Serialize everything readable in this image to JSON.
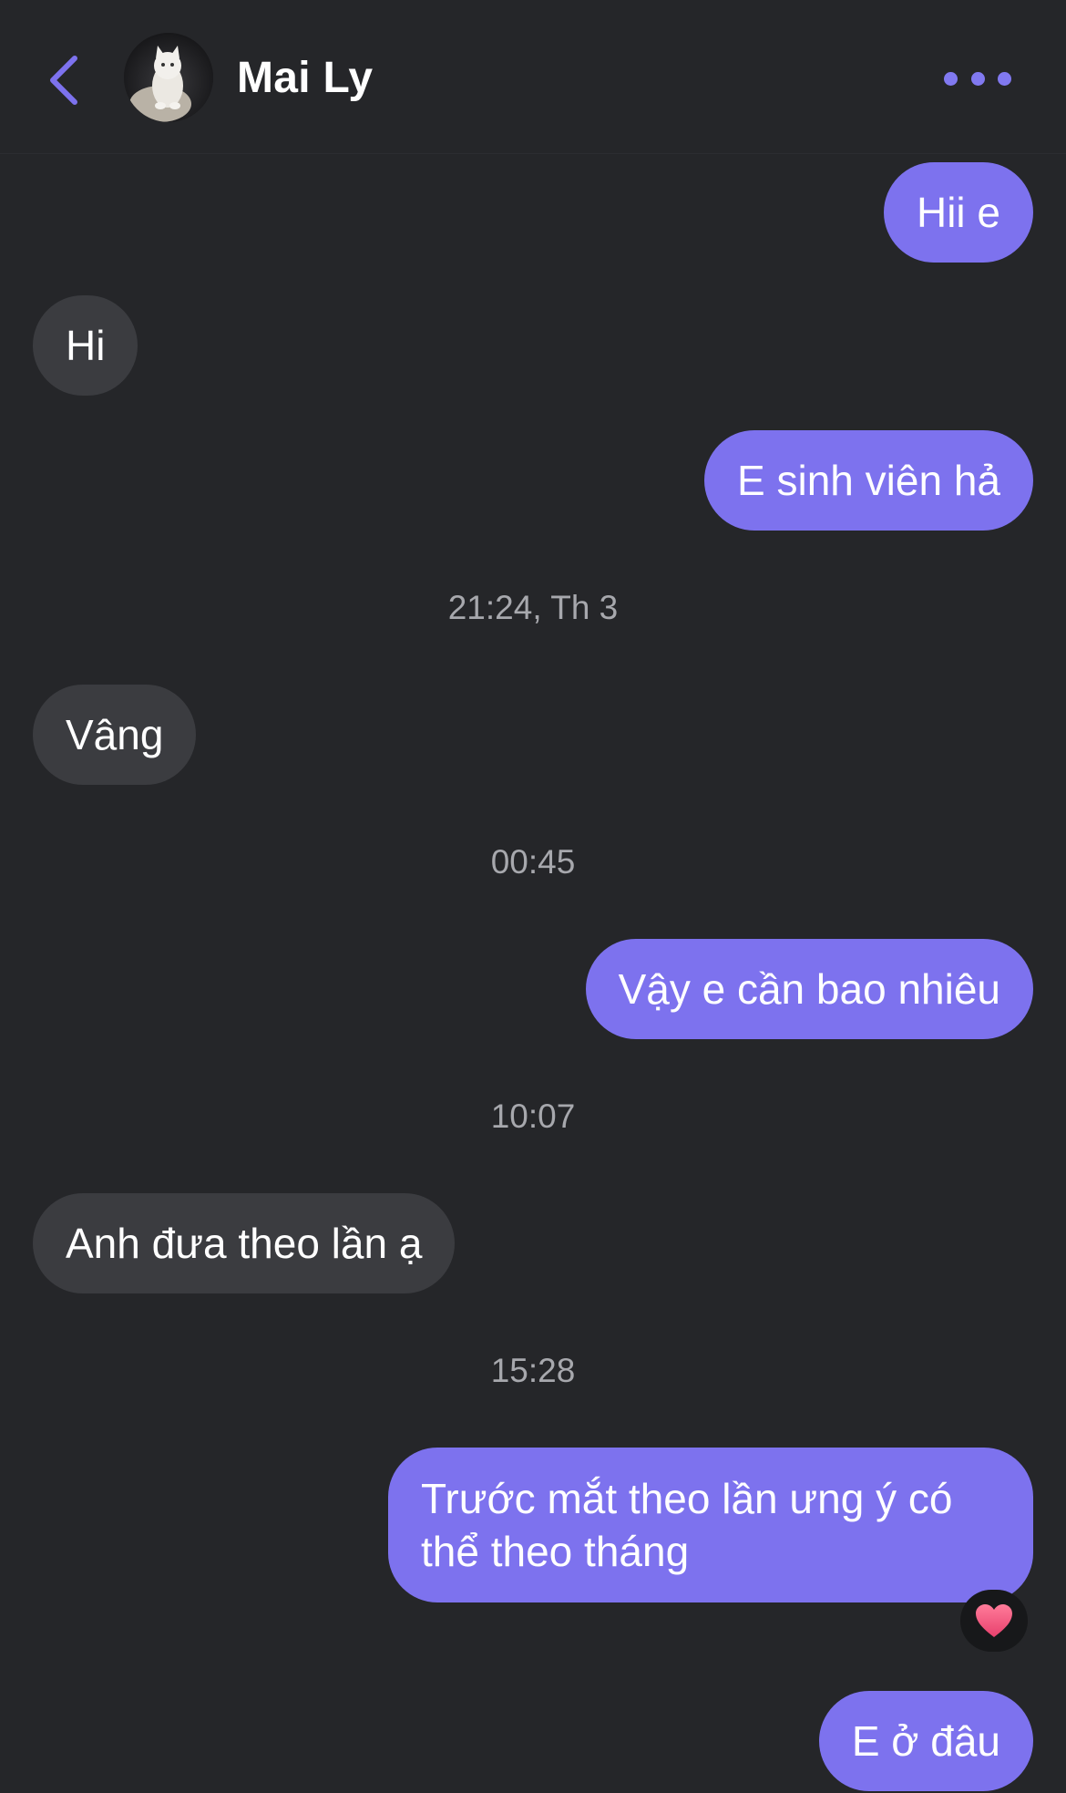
{
  "header": {
    "contact_name": "Mai Ly",
    "back_icon": "chevron-left-icon",
    "more_icon": "more-horizontal-icon",
    "accent_color": "#7d72ee"
  },
  "messages": [
    {
      "direction": "out",
      "text": "Hii e"
    },
    {
      "direction": "in",
      "text": "Hi"
    },
    {
      "direction": "out",
      "text": "E sinh viên hả"
    },
    {
      "type": "timestamp",
      "text": "21:24, Th 3"
    },
    {
      "direction": "in",
      "text": "Vâng"
    },
    {
      "type": "timestamp",
      "text": "00:45"
    },
    {
      "direction": "out",
      "text": "Vậy e cần bao nhiêu"
    },
    {
      "type": "timestamp",
      "text": "10:07"
    },
    {
      "direction": "in",
      "text": "Anh đưa theo lần ạ"
    },
    {
      "type": "timestamp",
      "text": "15:28"
    },
    {
      "direction": "out",
      "text": "Trước mắt theo lần ưng ý có thể theo tháng",
      "reaction": "heart-icon"
    },
    {
      "direction": "out",
      "text": "E ở đâu"
    }
  ],
  "colors": {
    "background": "#252629",
    "outgoing_bubble": "#7d72ee",
    "incoming_bubble": "#3b3c40",
    "reaction_heart": "#f2577f"
  }
}
